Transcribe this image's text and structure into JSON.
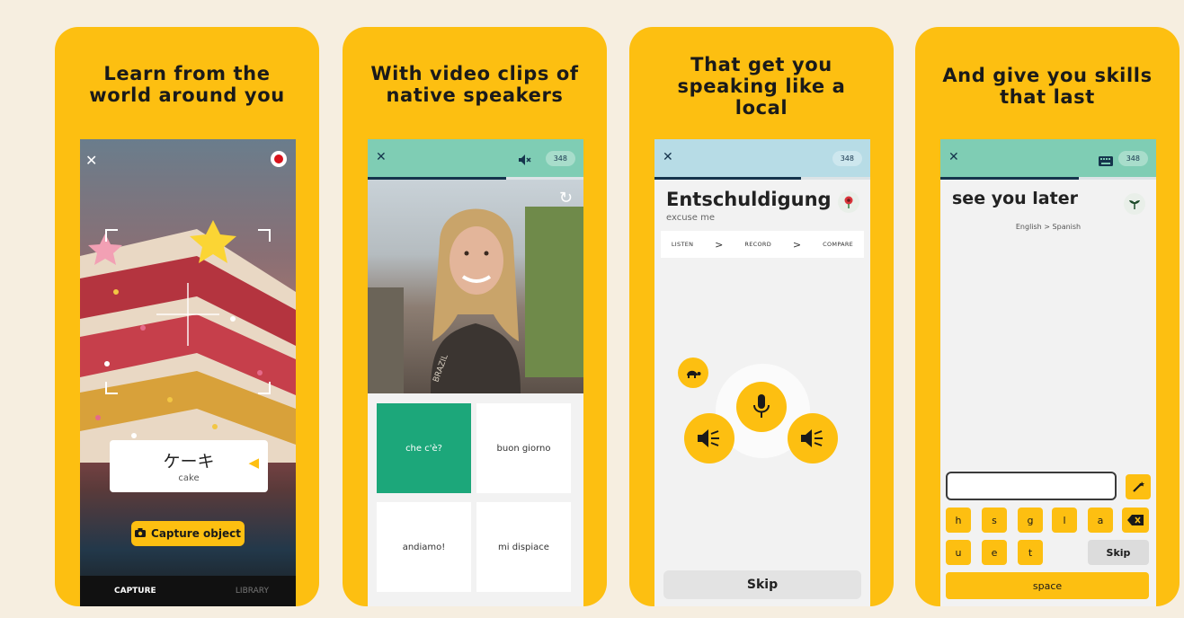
{
  "card1": {
    "title_line1": "Learn from the",
    "title_line2": "world around you",
    "close_glyph": "✕",
    "label_word": "ケーキ",
    "label_translation": "cake",
    "capture_button": "Capture object",
    "tabs": [
      "CAPTURE",
      "LIBRARY"
    ]
  },
  "card2": {
    "title_line1": "With video clips of",
    "title_line2": "native speakers",
    "close_glyph": "✕",
    "score": "348",
    "options": [
      "che c'è?",
      "buon giorno",
      "andiamo!",
      "mi dispiace"
    ],
    "video_caption": "BRAZIL"
  },
  "card3": {
    "title_line1": "That get you",
    "title_line2": "speaking like a",
    "title_line3": "local",
    "close_glyph": "✕",
    "score": "348",
    "word": "Entschuldigung",
    "translation": "excuse me",
    "steps": [
      "LISTEN",
      "RECORD",
      "COMPARE"
    ],
    "step_sep": ">",
    "skip": "Skip"
  },
  "card4": {
    "title_line1": "And give you skills",
    "title_line2": "that last",
    "close_glyph": "✕",
    "score": "348",
    "phrase": "see you later",
    "direction": "English > Spanish",
    "keys_row1": [
      "h",
      "s",
      "g",
      "l",
      "a"
    ],
    "keys_row2": [
      "u",
      "e",
      "t"
    ],
    "skip": "Skip",
    "space": "space"
  },
  "colors": {
    "background": "#f6eee0",
    "card": "#fdbf11",
    "header": "#7fcdb4",
    "navy": "#15344c",
    "correct": "#1ca77a"
  },
  "icons": [
    "close-icon",
    "record-icon",
    "speaker-icon",
    "camera-icon",
    "mute-icon",
    "replay-icon",
    "flower-badge-icon",
    "plant-badge-icon",
    "turtle-icon",
    "microphone-icon",
    "keyboard-icon",
    "magic-wand-icon",
    "backspace-icon"
  ]
}
